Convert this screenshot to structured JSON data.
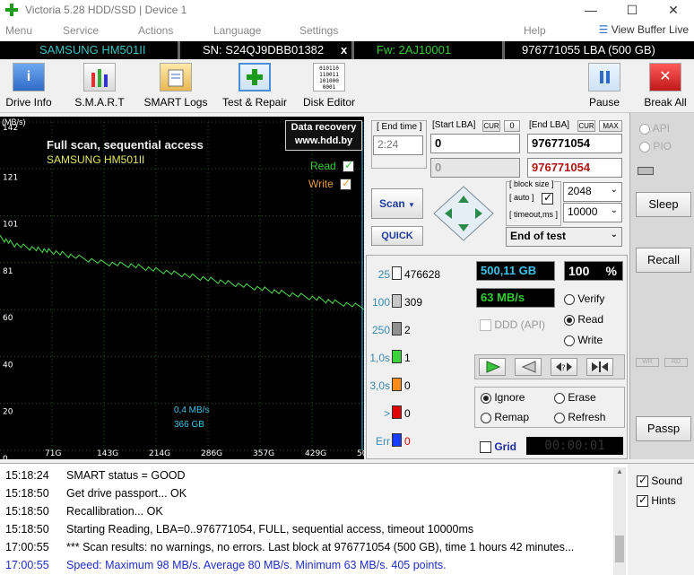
{
  "window": {
    "title": "Victoria 5.28 HDD/SSD | Device 1",
    "min": "—",
    "max": "☐",
    "close": "✕"
  },
  "menu": {
    "items": [
      "Menu",
      "Service",
      "Actions",
      "Language",
      "Settings",
      "Help"
    ],
    "view_buffer": "View Buffer Live"
  },
  "device": {
    "model": "SAMSUNG HM501II",
    "serial": "SN: S24QJ9DBB01382",
    "x": "x",
    "firmware": "Fw: 2AJ10001",
    "capacity": "976771055 LBA (500 GB)"
  },
  "toolbar": {
    "drive_info": "Drive Info",
    "smart": "S.M.A.R.T",
    "smart_logs": "SMART Logs",
    "test_repair": "Test & Repair",
    "disk_editor": "Disk Editor",
    "pause": "Pause",
    "break_all": "Break All",
    "disk_editor_bits": "010110\n110011\n101000\n0001"
  },
  "graph": {
    "unit": "(MB/s)",
    "title": "Full scan, sequential access",
    "device": "SAMSUNG HM501II",
    "recovery_line1": "Data recovery",
    "recovery_line2": "www.hdd.by",
    "read_label": "Read",
    "write_label": "Write",
    "speed_readout": "0,4 MB/s",
    "pos_readout": "366 GB",
    "y_ticks": [
      "142",
      "121",
      "101",
      "81",
      "60",
      "40",
      "20",
      "0"
    ],
    "x_ticks": [
      "71G",
      "143G",
      "214G",
      "286G",
      "357G",
      "429G",
      "50"
    ]
  },
  "chart_data": {
    "type": "line",
    "title": "Full scan, sequential access",
    "ylabel": "(MB/s)",
    "ylim": [
      0,
      142
    ],
    "xlim_gb": [
      0,
      500
    ],
    "series": [
      {
        "name": "Read",
        "x": [
          0,
          20,
          50,
          71,
          100,
          143,
          180,
          214,
          250,
          286,
          320,
          357,
          390,
          429,
          460,
          500
        ],
        "values": [
          92,
          89,
          87,
          86,
          84,
          81,
          80,
          78,
          76,
          74,
          72,
          70,
          68,
          66,
          64,
          62
        ]
      }
    ],
    "grid": true
  },
  "controls": {
    "end_time_label": "[ End time ]",
    "end_time": "2:24",
    "start_lba_label": "[Start LBA]",
    "cur1": "CUR",
    "zero": "0",
    "end_lba_label": "[End LBA]",
    "cur2": "CUR",
    "max": "MAX",
    "start_lba": "0",
    "end_lba": "976771054",
    "start_lba2": "0",
    "end_lba2": "976771054",
    "scan_btn": "Scan",
    "quick_btn": "QUICK",
    "block_size_label": "[ block size ]",
    "auto_label": "[ auto ]",
    "timeout_label": "[ timeout,ms ]",
    "block_size": "2048",
    "timeout": "10000",
    "end_action": "End of test"
  },
  "stats": {
    "rows": [
      {
        "label": "25",
        "count": "476628",
        "color": "#ffffff"
      },
      {
        "label": "100",
        "count": "309",
        "color": "#c8c8c8"
      },
      {
        "label": "250",
        "count": "2",
        "color": "#909090"
      },
      {
        "label": "1,0s",
        "count": "1",
        "color": "#3bd23b"
      },
      {
        "label": "3,0s",
        "count": "0",
        "color": "#ff8c1a"
      },
      {
        "label": ">",
        "count": "0",
        "color": "#e00000"
      },
      {
        "label": "Err",
        "count": "0",
        "color": "#1a3cff"
      }
    ],
    "position": "500,11 GB",
    "percent": "100",
    "percent_sign": "%",
    "speed": "63 MB/s",
    "verify": "Verify",
    "read": "Read",
    "write": "Write",
    "ddd": "DDD (API)",
    "ignore": "Ignore",
    "erase": "Erase",
    "remap": "Remap",
    "refresh": "Refresh",
    "grid": "Grid",
    "timer": "00:00:01"
  },
  "side": {
    "api": "API",
    "pio": "PIO",
    "sleep": "Sleep",
    "recall": "Recall",
    "wr": "WR",
    "rd": "RD",
    "passp": "Passp",
    "sound": "Sound",
    "hints": "Hints"
  },
  "log": [
    {
      "time": "15:18:24",
      "msg": "SMART status = GOOD",
      "color": "#000000"
    },
    {
      "time": "15:18:50",
      "msg": "Get drive passport... OK",
      "color": "#000000"
    },
    {
      "time": "15:18:50",
      "msg": "Recallibration... OK",
      "color": "#000000"
    },
    {
      "time": "15:18:50",
      "msg": "Starting Reading, LBA=0..976771054, FULL, sequential access, timeout 10000ms",
      "color": "#000000"
    },
    {
      "time": "17:00:55",
      "msg": "*** Scan results: no warnings, no errors. Last block at 976771054 (500 GB), time 1 hours 42 minutes...",
      "color": "#000000"
    },
    {
      "time": "17:00:55",
      "msg": "Speed: Maximum 98 MB/s. Average 80 MB/s. Minimum 63 MB/s. 405 points.",
      "color": "#1f2ec8"
    }
  ]
}
